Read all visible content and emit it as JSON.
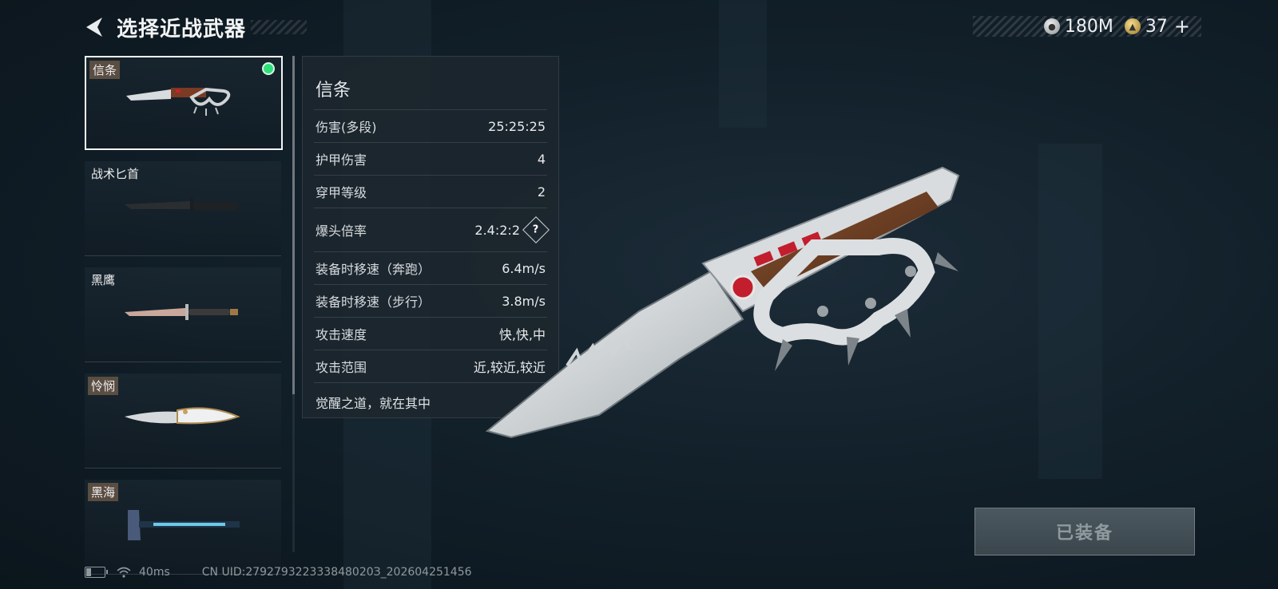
{
  "header": {
    "title": "选择近战武器"
  },
  "currency": {
    "silver": "180M",
    "gold": "37",
    "plus": "+"
  },
  "weapons": [
    {
      "label": "信条",
      "selected": true,
      "equipped": true,
      "tag": true
    },
    {
      "label": "战术匕首",
      "selected": false,
      "equipped": false,
      "tag": false
    },
    {
      "label": "黑鹰",
      "selected": false,
      "equipped": false,
      "tag": false
    },
    {
      "label": "怜悯",
      "selected": false,
      "equipped": false,
      "tag": true
    },
    {
      "label": "黑海",
      "selected": false,
      "equipped": false,
      "tag": true
    }
  ],
  "stats": {
    "name": "信条",
    "rows": [
      {
        "key": "伤害(多段)",
        "value": "25:25:25"
      },
      {
        "key": "护甲伤害",
        "value": "4"
      },
      {
        "key": "穿甲等级",
        "value": "2"
      },
      {
        "key": "爆头倍率",
        "value": "2.4:2:2"
      },
      {
        "key": "装备时移速（奔跑）",
        "value": "6.4m/s"
      },
      {
        "key": "装备时移速（步行）",
        "value": "3.8m/s"
      },
      {
        "key": "攻击速度",
        "value": "快,快,中"
      },
      {
        "key": "攻击范围",
        "value": "近,较近,较近"
      }
    ],
    "help": "?",
    "flavor": "觉醒之道，就在其中"
  },
  "equip_button": "已装备",
  "status": {
    "ping": "40ms",
    "uid": "CN UID:279279322333848020З_202604251456",
    "battery_level": 0.35
  },
  "colors": {
    "accent_green": "#2fe07a",
    "background": "#12202a"
  }
}
